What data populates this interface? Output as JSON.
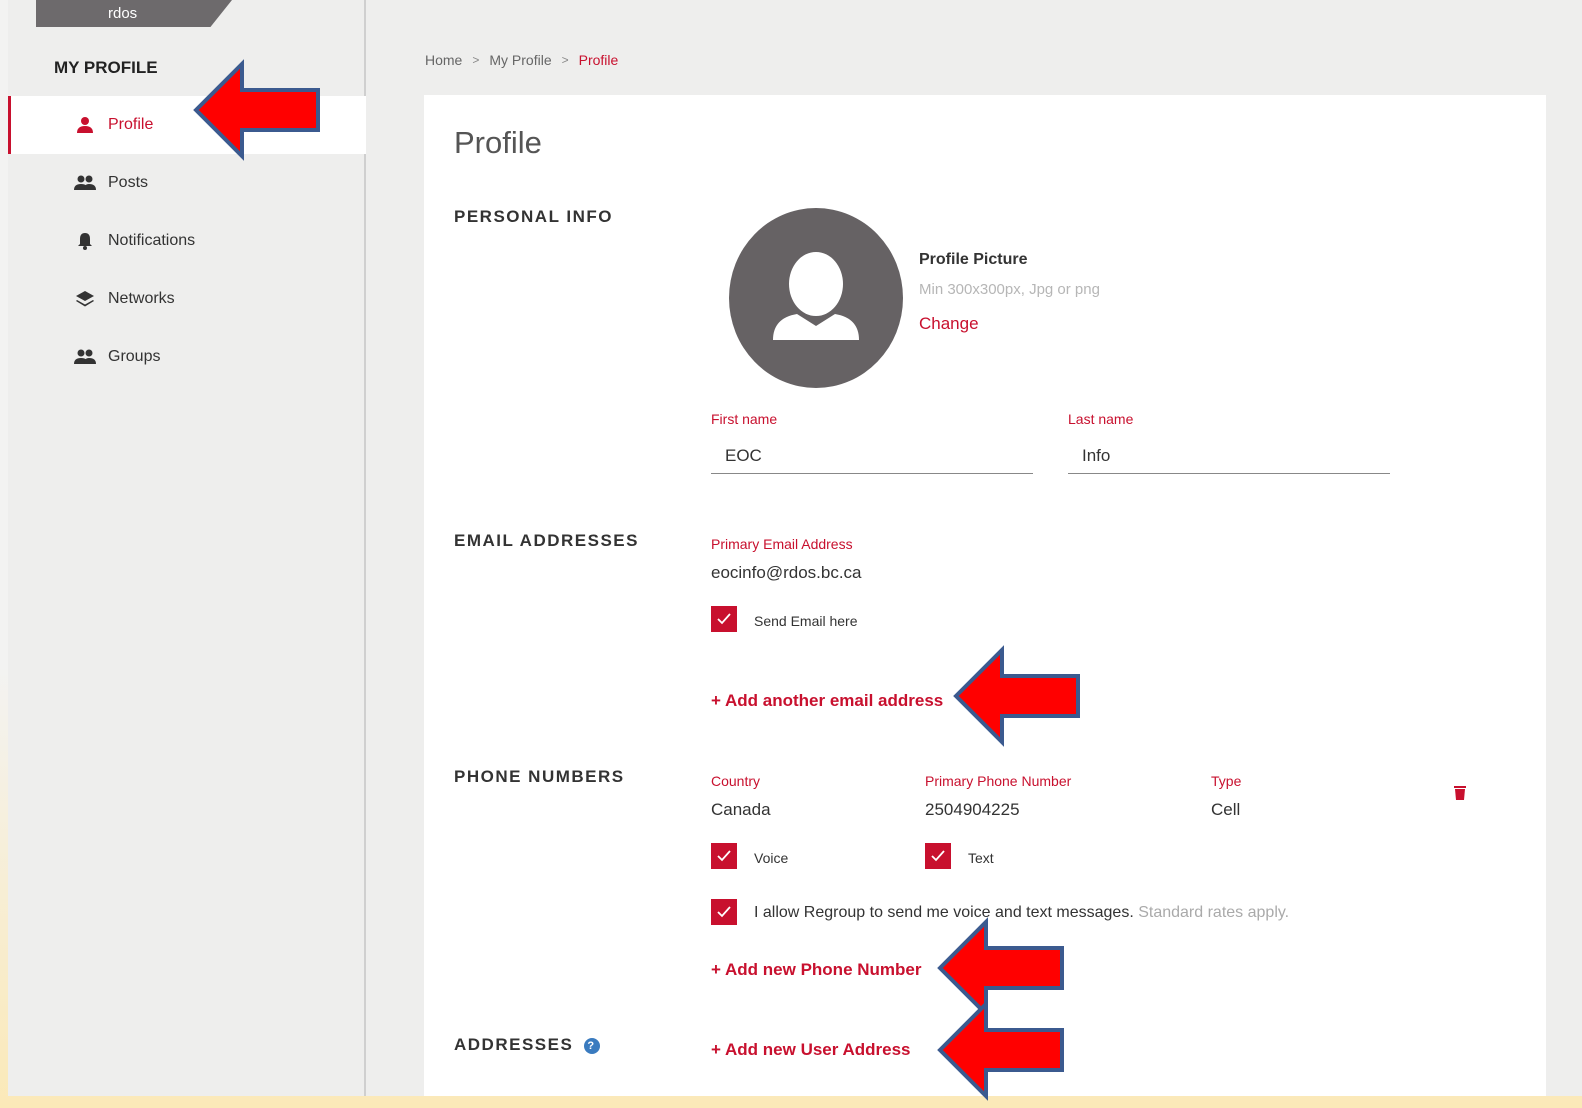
{
  "org": {
    "name": "rdos"
  },
  "sidebar": {
    "title": "MY PROFILE",
    "items": [
      {
        "label": "Profile",
        "icon": "person-icon",
        "active": true
      },
      {
        "label": "Posts",
        "icon": "people-icon",
        "active": false
      },
      {
        "label": "Notifications",
        "icon": "bell-icon",
        "active": false
      },
      {
        "label": "Networks",
        "icon": "layers-icon",
        "active": false
      },
      {
        "label": "Groups",
        "icon": "people-icon",
        "active": false
      }
    ]
  },
  "breadcrumb": {
    "home": "Home",
    "parent": "My Profile",
    "current": "Profile",
    "separator": ">"
  },
  "page": {
    "title": "Profile"
  },
  "personal_info": {
    "heading": "PERSONAL INFO",
    "picture_label": "Profile Picture",
    "picture_hint": "Min 300x300px, Jpg or png",
    "change_label": "Change",
    "first_name_label": "First name",
    "first_name_value": "EOC",
    "last_name_label": "Last name",
    "last_name_value": "Info"
  },
  "email": {
    "heading": "EMAIL ADDRESSES",
    "primary_label": "Primary Email Address",
    "primary_value": "eocinfo@rdos.bc.ca",
    "send_here_label": "Send Email here",
    "add_label": "+ Add another email address"
  },
  "phone": {
    "heading": "PHONE NUMBERS",
    "country_label": "Country",
    "country_value": "Canada",
    "number_label": "Primary Phone Number",
    "number_value": "2504904225",
    "type_label": "Type",
    "type_value": "Cell",
    "voice_label": "Voice",
    "text_label": "Text",
    "consent_text": "I allow Regroup to send me voice and text messages.",
    "consent_note": "Standard rates apply.",
    "add_label": "+ Add new Phone Number"
  },
  "addresses": {
    "heading": "ADDRESSES",
    "help_glyph": "?",
    "add_label": "+ Add new User Address"
  },
  "colors": {
    "accent": "#c8102e",
    "annotation_arrow": "#ff0000",
    "arrow_outline": "#3b5a8f",
    "avatar": "#666264"
  }
}
